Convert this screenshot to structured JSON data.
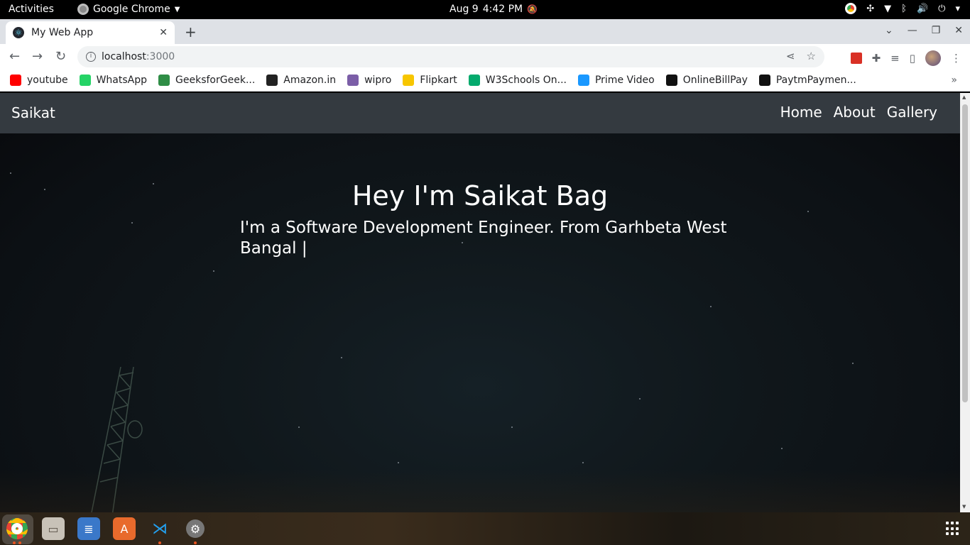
{
  "os": {
    "activities": "Activities",
    "app_name": "Google Chrome",
    "date": "Aug 9",
    "time": "4:42 PM"
  },
  "browser": {
    "tab_title": "My Web App",
    "url_host": "localhost",
    "url_port": ":3000",
    "bookmarks": [
      {
        "label": "youtube",
        "icon": "youtube-icon",
        "color": "#ff0000"
      },
      {
        "label": "WhatsApp",
        "icon": "whatsapp-icon",
        "color": "#25d366"
      },
      {
        "label": "GeeksforGeek...",
        "icon": "gfg-icon",
        "color": "#2f8d46"
      },
      {
        "label": "Amazon.in",
        "icon": "amazon-icon",
        "color": "#222222"
      },
      {
        "label": "wipro",
        "icon": "wipro-icon",
        "color": "#7b5ea7"
      },
      {
        "label": "Flipkart",
        "icon": "flipkart-icon",
        "color": "#f7c600"
      },
      {
        "label": "W3Schools On...",
        "icon": "w3schools-icon",
        "color": "#04aa6d"
      },
      {
        "label": "Prime Video",
        "icon": "prime-video-icon",
        "color": "#1a98ff"
      },
      {
        "label": "OnlineBillPay",
        "icon": "billpay-icon",
        "color": "#111111"
      },
      {
        "label": "PaytmPaymen...",
        "icon": "paytm-icon",
        "color": "#111111"
      }
    ]
  },
  "page": {
    "brand": "Saikat",
    "nav": [
      "Home",
      "About",
      "Gallery"
    ],
    "hero_title": "Hey I'm Saikat Bag",
    "hero_subtitle": "I'm a Software Development Engineer. From Garhbeta West Bangal |"
  }
}
